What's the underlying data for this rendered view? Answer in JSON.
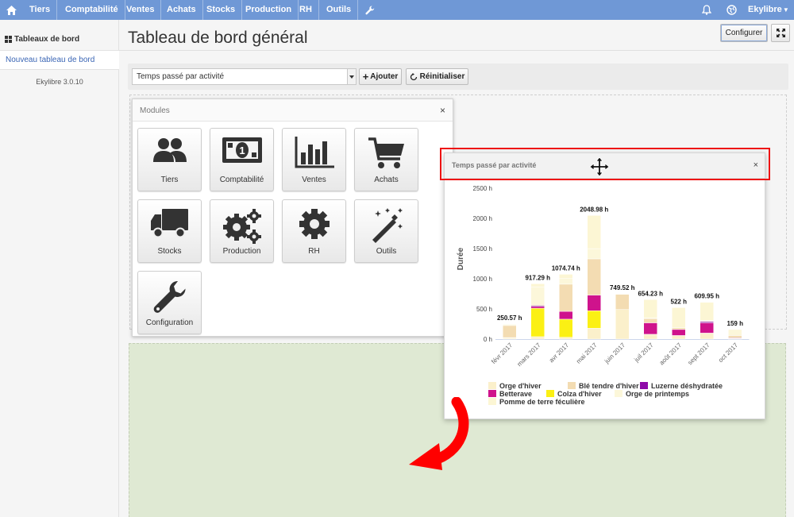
{
  "nav": {
    "items": [
      "Tiers",
      "Comptabilité",
      "Ventes",
      "Achats",
      "Stocks",
      "Production",
      "RH",
      "Outils"
    ],
    "user": "Ekylibre"
  },
  "sidebar": {
    "title": "Tableaux de bord",
    "active_item": "Nouveau tableau de bord",
    "version": "Ekylibre 3.0.10"
  },
  "main": {
    "title": "Tableau de bord général",
    "configure_label": "Configurer",
    "select_value": "Temps passé par activité",
    "add_label": "Ajouter",
    "reset_label": "Réinitialiser"
  },
  "modules": {
    "title": "Modules",
    "tiles": [
      "Tiers",
      "Comptabilité",
      "Ventes",
      "Achats",
      "Stocks",
      "Production",
      "RH",
      "Outils",
      "Configuration"
    ]
  },
  "widget": {
    "title": "Temps passé par activité"
  },
  "colors": {
    "nav": "#6f98d6",
    "orge_hiver": "#fbf0cb",
    "ble_tendre_hiver": "#f3dcb2",
    "luzerne": "#8e0aa8",
    "betterave": "#cf138c",
    "colza": "#fbf014",
    "orge_printemps": "#fcf7da",
    "pomme_de_terre": "#fcf6d4",
    "highlight": "#ee1111"
  },
  "chart_data": {
    "type": "bar",
    "stacked": true,
    "ylabel": "Durée",
    "ylim": [
      0,
      2500
    ],
    "yticks": [
      "0 h",
      "500 h",
      "1000 h",
      "1500 h",
      "2000 h",
      "2500 h"
    ],
    "categories": [
      "févr 2017",
      "mars 2017",
      "avr 2017",
      "mai 2017",
      "juin 2017",
      "juil 2017",
      "août 2017",
      "sept 2017",
      "oct 2017"
    ],
    "totals_labels": [
      "250.57 h",
      "917.29 h",
      "1074.74 h",
      "2048.98 h",
      "749.52 h",
      "654.23 h",
      "522 h",
      "609.95 h",
      "159 h"
    ],
    "series": [
      {
        "name": "Orge d'hiver",
        "color": "#fbf0cb",
        "values": [
          20,
          40,
          30,
          180,
          490,
          80,
          60,
          100,
          10
        ]
      },
      {
        "name": "Colza d'hiver",
        "color": "#fbf014",
        "values": [
          5,
          470,
          300,
          290,
          0,
          0,
          0,
          0,
          0
        ]
      },
      {
        "name": "Betterave",
        "color": "#cf138c",
        "values": [
          0,
          30,
          130,
          260,
          0,
          190,
          100,
          170,
          0
        ]
      },
      {
        "name": "Luzerne déshydratée",
        "color": "#8e0aa8",
        "values": [
          0,
          15,
          0,
          0,
          0,
          0,
          0,
          20,
          10
        ]
      },
      {
        "name": "Blé tendre d'hiver",
        "color": "#f3dcb2",
        "values": [
          200,
          20,
          450,
          600,
          250,
          70,
          30,
          10,
          40
        ]
      },
      {
        "name": "Orge de printemps",
        "color": "#fcf7da",
        "values": [
          15,
          292,
          94,
          169,
          10,
          14,
          0,
          10,
          99
        ]
      },
      {
        "name": "Pomme de terre féculière",
        "color": "#fcf6d4",
        "values": [
          10,
          50,
          70,
          550,
          0,
          300,
          332,
          300,
          0
        ]
      }
    ],
    "legend_position": "bottom",
    "grid": false
  }
}
